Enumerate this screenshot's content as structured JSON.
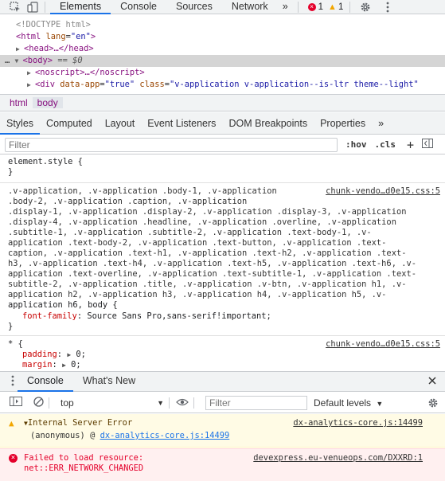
{
  "toolbar": {
    "tabs": [
      "Elements",
      "Console",
      "Sources",
      "Network"
    ],
    "more": "»",
    "error_count": "1",
    "warning_count": "1"
  },
  "dom": {
    "line1": "<!DOCTYPE html>",
    "line2_tag_open": "<html",
    "line2_attr": "lang",
    "line2_val": "\"en\"",
    "line2_close": ">",
    "line3": "<head>…</head>",
    "line4_prefix": "…",
    "line4_tag": "<body>",
    "line4_eq": "== $0",
    "line5": "<noscript>…</noscript>",
    "line6_tag": "<div",
    "line6_attr1": "data-app",
    "line6_val1": "\"true\"",
    "line6_attr2": "class",
    "line6_val2": "\"v-application v-application--is-ltr theme--light\""
  },
  "breadcrumbs": [
    "html",
    "body"
  ],
  "subtabs": [
    "Styles",
    "Computed",
    "Layout",
    "Event Listeners",
    "DOM Breakpoints",
    "Properties"
  ],
  "subtabs_more": "»",
  "styles_filter": {
    "placeholder": "Filter",
    "hov": ":hov",
    "cls": ".cls",
    "plus": "+"
  },
  "styles": {
    "element_style": "element.style {",
    "close": "}",
    "rule1_source": "chunk-vendo…d0e15.css:5",
    "rule1_selectors": [
      ".v-application, .v-application .body-1, .v-application",
      ".body-2, .v-application .caption, .v-application",
      ".display-1, .v-application .display-2, .v-application .display-3, .v-application",
      ".display-4, .v-application .headline, .v-application .overline, .v-application",
      ".subtitle-1, .v-application .subtitle-2, .v-application .text-body-1, .v-",
      "application .text-body-2, .v-application .text-button, .v-application .text-",
      "caption, .v-application .text-h1, .v-application .text-h2, .v-application .text-",
      "h3, .v-application .text-h4, .v-application .text-h5, .v-application .text-h6, .v-",
      "application .text-overline, .v-application .text-subtitle-1, .v-application .text-",
      "subtitle-2, .v-application .title, .v-application .v-btn, .v-application h1, .v-",
      "application h2, .v-application h3, .v-application h4, .v-application h5, .v-"
    ],
    "rule1_last_selector": "application h6, body {",
    "rule1_prop": "font-family",
    "rule1_value": "Source Sans Pro,sans-serif!important;",
    "rule2_selector": "* {",
    "rule2_source": "chunk-vendo…d0e15.css:5",
    "rule2_prop1": "padding",
    "rule2_val1": "0;",
    "rule2_prop2": "margin",
    "rule2_val2": "0;"
  },
  "drawer": {
    "tabs": [
      "Console",
      "What's New"
    ]
  },
  "console_toolbar": {
    "context": "top",
    "filter_placeholder": "Filter",
    "levels": "Default levels"
  },
  "messages": {
    "warn_text": "Internal Server Error",
    "warn_source": "dx-analytics-core.js:14499",
    "warn_stack_prefix": "(anonymous) @",
    "warn_stack_link": "dx-analytics-core.js:14499",
    "err_line1": "Failed to load resource:",
    "err_line2": "net::ERR_NETWORK_CHANGED",
    "err_source": "devexpress.eu-venueops.com/DXXRD:1"
  },
  "colors": {
    "accent": "#1a73e8",
    "error": "#e4002b",
    "warning": "#f2a600"
  }
}
